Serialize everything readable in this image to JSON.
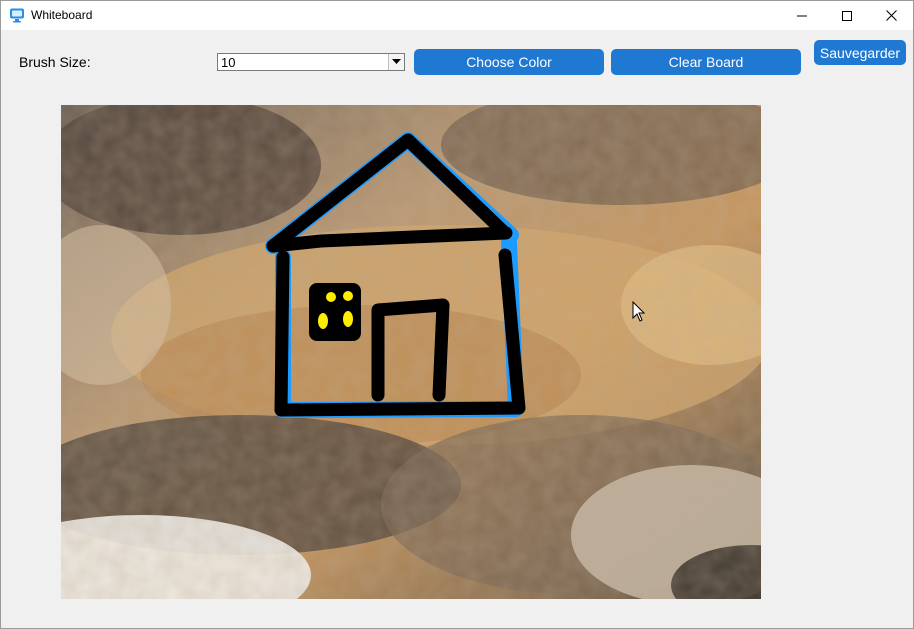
{
  "window": {
    "title": "Whiteboard"
  },
  "toolbar": {
    "brush_label": "Brush Size:",
    "brush_value": "10",
    "choose_color_label": "Choose Color",
    "clear_board_label": "Clear Board",
    "save_label": "Sauvegarder"
  },
  "colors": {
    "button": "#1f78d1",
    "stroke": "#000000",
    "stroke_outline": "#1e9bff",
    "window_fill": "#ffee00"
  },
  "icons": {
    "app": "whiteboard-app-icon",
    "minimize": "minimize-icon",
    "maximize": "maximize-icon",
    "close": "close-icon",
    "dropdown": "chevron-down-icon",
    "cursor": "mouse-pointer-icon"
  }
}
